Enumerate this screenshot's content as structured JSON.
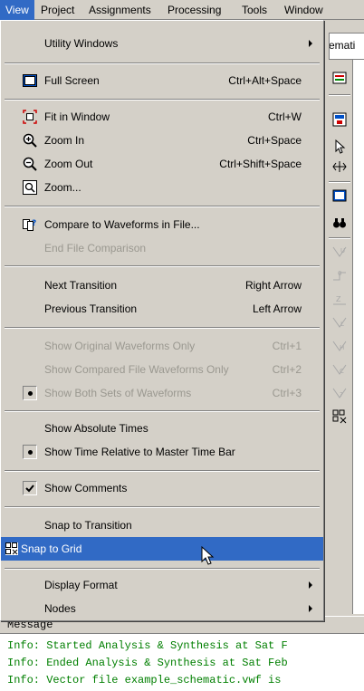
{
  "menubar": {
    "items": [
      "View",
      "Project",
      "Assignments",
      "Processing",
      "Tools",
      "Window"
    ]
  },
  "document": {
    "tab_fragment": "emati"
  },
  "view_menu": {
    "items": [
      {
        "label": "Utility Windows",
        "submenu": true
      },
      {
        "label": "Full Screen",
        "shortcut": "Ctrl+Alt+Space",
        "icon": "full-screen-icon"
      },
      {
        "label": "Fit in Window",
        "shortcut": "Ctrl+W",
        "icon": "fit-in-window-icon"
      },
      {
        "label": "Zoom In",
        "shortcut": "Ctrl+Space",
        "icon": "zoom-in-icon"
      },
      {
        "label": "Zoom Out",
        "shortcut": "Ctrl+Shift+Space",
        "icon": "zoom-out-icon"
      },
      {
        "label": "Zoom...",
        "icon": "zoom-icon"
      },
      {
        "label": "Compare to Waveforms in File...",
        "icon": "compare-waveforms-icon"
      },
      {
        "label": "End File Comparison",
        "disabled": true
      },
      {
        "label": "Next Transition",
        "shortcut": "Right Arrow"
      },
      {
        "label": "Previous Transition",
        "shortcut": "Left Arrow"
      },
      {
        "label": "Show Original Waveforms Only",
        "shortcut": "Ctrl+1",
        "disabled": true
      },
      {
        "label": "Show Compared File Waveforms Only",
        "shortcut": "Ctrl+2",
        "disabled": true
      },
      {
        "label": "Show Both Sets of Waveforms",
        "shortcut": "Ctrl+3",
        "disabled": true,
        "radio_selected": true
      },
      {
        "label": "Show Absolute Times"
      },
      {
        "label": "Show Time Relative to Master Time Bar",
        "radio_selected": true
      },
      {
        "label": "Show Comments",
        "checked": true
      },
      {
        "label": "Snap to Transition"
      },
      {
        "label": "Snap to Grid",
        "highlighted": true,
        "icon": "snap-to-grid-icon"
      },
      {
        "label": "Display Format",
        "submenu": true
      },
      {
        "label": "Nodes",
        "submenu": true
      }
    ]
  },
  "messages": {
    "header": "Message",
    "lines": [
      "Info: Started Analysis & Synthesis at Sat F",
      "Info: Ended Analysis & Synthesis at Sat Feb",
      "Info: Vector file example_schematic.vwf is"
    ]
  },
  "colors": {
    "menu_bg": "#d4d0c8",
    "highlight": "#316ac5",
    "message_text": "#007f00",
    "disabled_text": "#9a9890"
  }
}
